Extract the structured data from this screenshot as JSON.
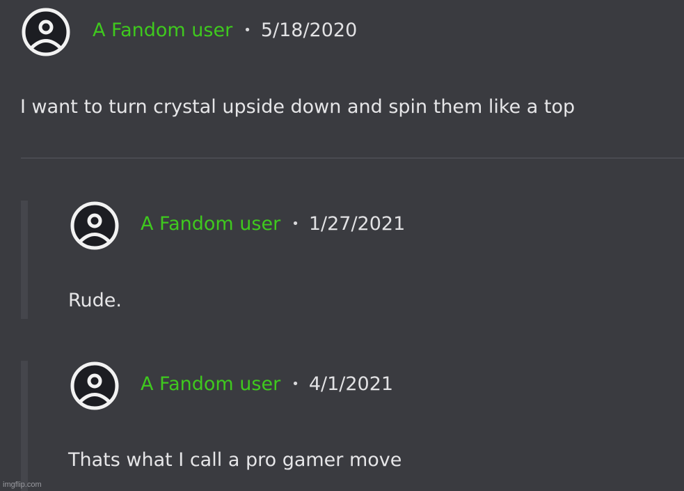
{
  "comments": [
    {
      "username": "A Fandom user",
      "separator": "•",
      "date": "5/18/2020",
      "text": "I want to turn crystal upside down and spin them like a top",
      "avatar_icon": "user-circle-icon"
    }
  ],
  "replies": [
    {
      "username": "A Fandom user",
      "separator": "•",
      "date": "1/27/2021",
      "text": "Rude.",
      "avatar_icon": "user-circle-icon"
    },
    {
      "username": "A Fandom user",
      "separator": "•",
      "date": "4/1/2021",
      "text": "Thats what I call a pro gamer move",
      "avatar_icon": "user-circle-icon"
    }
  ],
  "watermark": "imgflip.com",
  "colors": {
    "background": "#3a3b40",
    "username": "#3fc91e",
    "text": "#e6e6e8",
    "reply_bar": "#45464c"
  }
}
